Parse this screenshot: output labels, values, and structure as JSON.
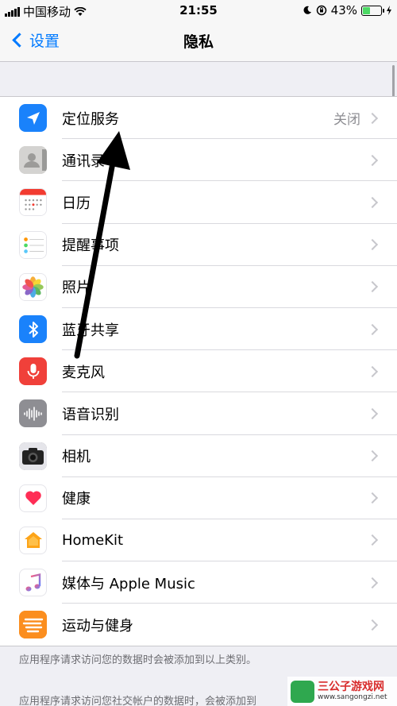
{
  "status": {
    "carrier": "中国移动",
    "time": "21:55",
    "battery_percent": "43%",
    "battery_level": 0.43
  },
  "nav": {
    "back_label": "设置",
    "title": "隐私"
  },
  "items": [
    {
      "label": "定位服务",
      "value": "关闭",
      "icon": "location-arrow-icon",
      "color": "#1a82fb"
    },
    {
      "label": "通讯录",
      "value": "",
      "icon": "contacts-icon",
      "color": "#d4d3d1"
    },
    {
      "label": "日历",
      "value": "",
      "icon": "calendar-icon",
      "color": "#ffffff"
    },
    {
      "label": "提醒事项",
      "value": "",
      "icon": "reminders-icon",
      "color": "#ffffff"
    },
    {
      "label": "照片",
      "value": "",
      "icon": "photos-icon",
      "color": "#ffffff"
    },
    {
      "label": "蓝牙共享",
      "value": "",
      "icon": "bluetooth-icon",
      "color": "#1a82fb"
    },
    {
      "label": "麦克风",
      "value": "",
      "icon": "microphone-icon",
      "color": "#f0403a"
    },
    {
      "label": "语音识别",
      "value": "",
      "icon": "speech-recognition-icon",
      "color": "#8e8e93"
    },
    {
      "label": "相机",
      "value": "",
      "icon": "camera-icon",
      "color": "#7c7c80"
    },
    {
      "label": "健康",
      "value": "",
      "icon": "health-heart-icon",
      "color": "#ffffff"
    },
    {
      "label": "HomeKit",
      "value": "",
      "icon": "homekit-house-icon",
      "color": "#ffffff"
    },
    {
      "label": "媒体与 Apple Music",
      "value": "",
      "icon": "music-note-icon",
      "color": "#ffffff"
    },
    {
      "label": "运动与健身",
      "value": "",
      "icon": "motion-fitness-icon",
      "color": "#fb8e1f"
    }
  ],
  "footer": {
    "note1": "应用程序请求访问您的数据时会被添加到以上类别。",
    "note2": "应用程序请求访问您社交帐户的数据时，会被添加到"
  },
  "watermark": {
    "title": "三公子游戏网",
    "url": "www.sangongzi.net"
  },
  "accent": "#007aff"
}
